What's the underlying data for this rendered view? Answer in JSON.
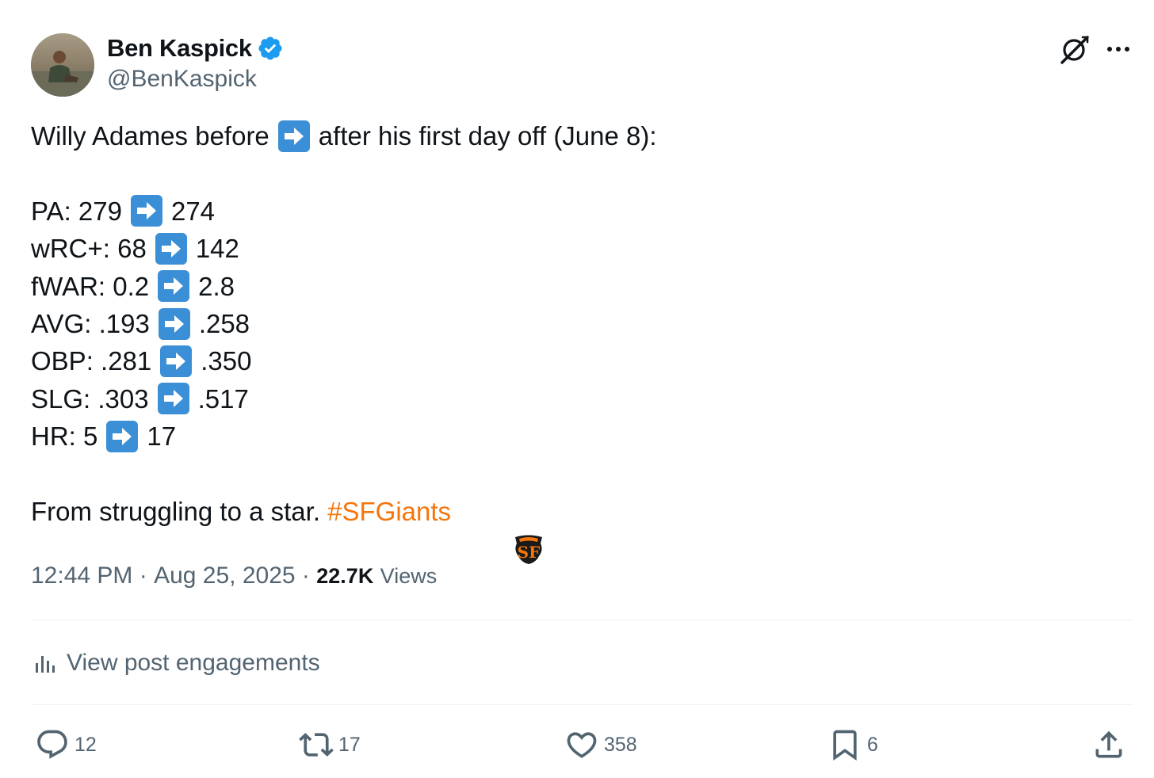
{
  "author": {
    "display_name": "Ben Kaspick",
    "handle": "@BenKaspick",
    "verified": true
  },
  "tweet": {
    "intro": "Willy Adames before",
    "intro_after": "after his first day off (June 8):",
    "stats": [
      {
        "label": "PA: 279",
        "after": "274"
      },
      {
        "label": "wRC+: 68",
        "after": "142"
      },
      {
        "label": "fWAR: 0.2",
        "after": "2.8"
      },
      {
        "label": "AVG: .193",
        "after": ".258"
      },
      {
        "label": "OBP: .281",
        "after": ".350"
      },
      {
        "label": "SLG: .303",
        "after": ".517"
      },
      {
        "label": "HR: 5",
        "after": "17"
      }
    ],
    "closing": "From struggling to a star.",
    "hashtag": "#SFGiants"
  },
  "meta": {
    "time": "12:44 PM",
    "sep": " · ",
    "date": "Aug 25, 2025",
    "views_count": "22.7K",
    "views_label": "Views"
  },
  "engagements_label": "View post engagements",
  "actions": {
    "replies": "12",
    "reposts": "17",
    "likes": "358",
    "bookmarks": "6"
  },
  "colors": {
    "text": "#0f1419",
    "secondary": "#536471",
    "hashtag": "#f4760b",
    "verified": "#1d9bf0",
    "arrow_emoji_bg": "#3a8fd6",
    "divider": "#eff3f4"
  },
  "icons": {
    "verified": "verified-badge-icon",
    "grok": "grok-icon",
    "more": "more-icon",
    "arrow": "right-arrow-emoji",
    "team": "sf-giants-logo",
    "engagements": "bar-chart-icon",
    "reply": "reply-icon",
    "repost": "repost-icon",
    "like": "heart-icon",
    "bookmark": "bookmark-icon",
    "share": "share-icon"
  }
}
